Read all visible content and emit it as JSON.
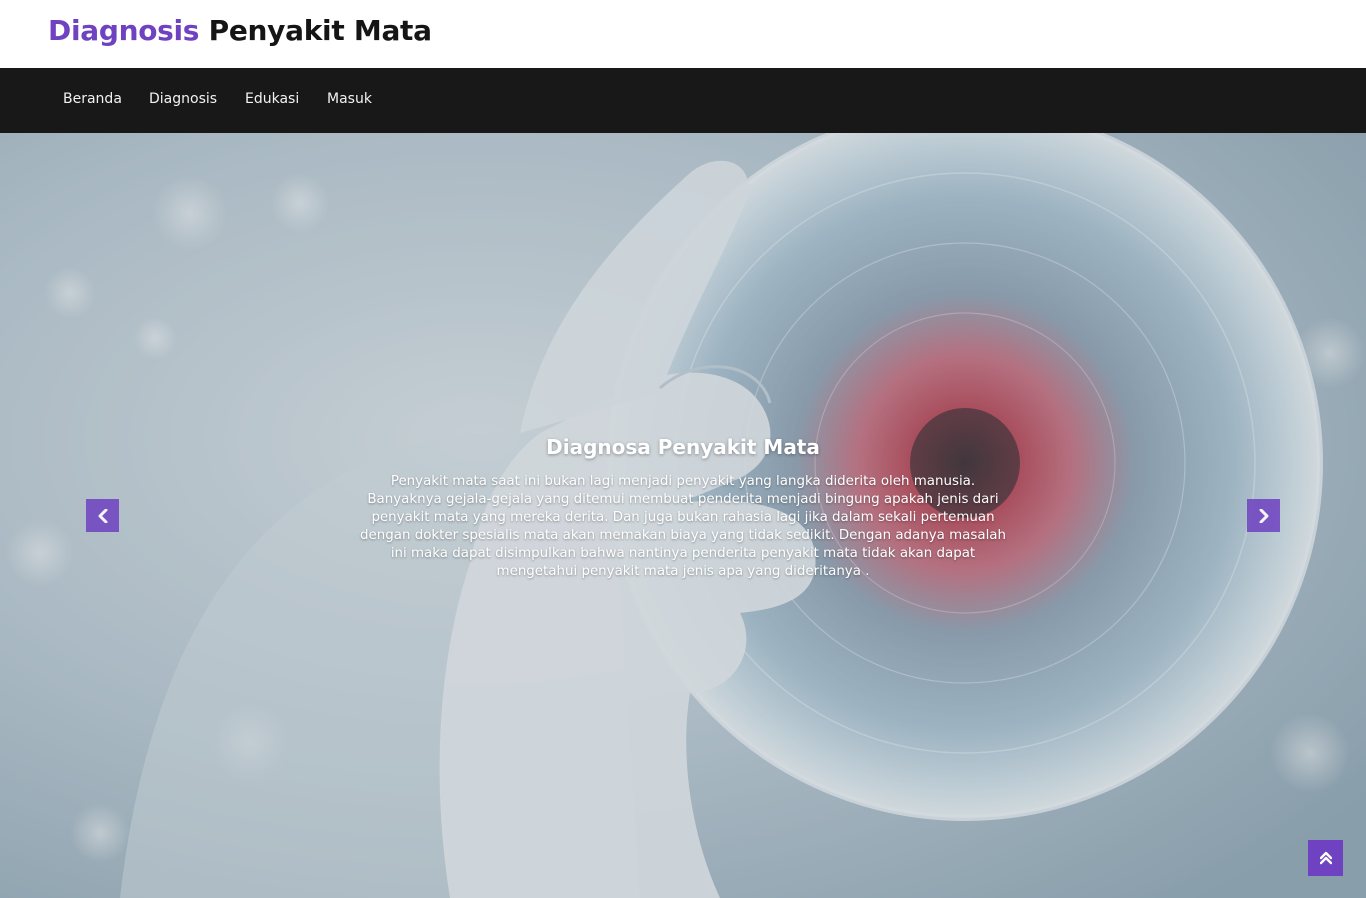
{
  "brand": {
    "accent": "Diagnosis",
    "rest": "Penyakit Mata"
  },
  "nav": [
    {
      "label": "Beranda"
    },
    {
      "label": "Diagnosis"
    },
    {
      "label": "Edukasi"
    },
    {
      "label": "Masuk"
    }
  ],
  "hero": {
    "title": "Diagnosa Penyakit Mata",
    "lines": [
      "Penyakit mata saat ini bukan lagi menjadi penyakit yang langka diderita oleh manusia.",
      "Banyaknya gejala-gejala yang ditemui membuat penderita menjadi bingung apakah jenis dari",
      "penyakit mata yang mereka derita. Dan juga bukan rahasia lagi jika dalam sekali pertemuan",
      "dengan dokter spesialis mata akan memakan biaya yang tidak sedikit. Dengan adanya masalah",
      "ini maka dapat disimpulkan bahwa nantinya penderita penyakit mata tidak akan dapat",
      "mengetahui penyakit mata jenis apa yang dideritanya ."
    ],
    "prev_icon": "chevron-left-icon",
    "next_icon": "chevron-right-icon"
  },
  "back_to_top_icon": "double-chevron-up-icon",
  "colors": {
    "accent": "#6f42c1",
    "navbar": "#181818",
    "text_dark": "#151515"
  }
}
